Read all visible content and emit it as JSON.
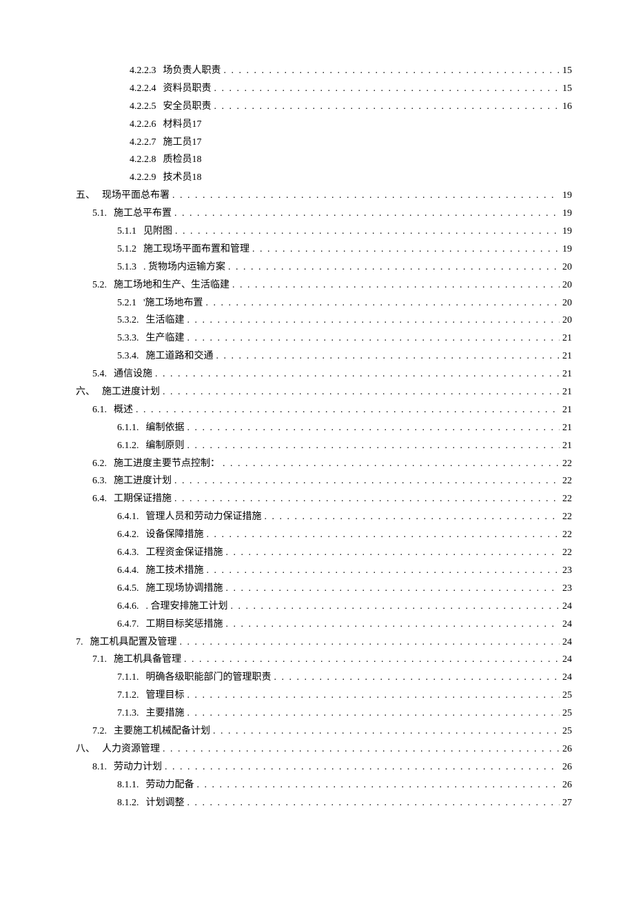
{
  "entries": [
    {
      "level": 4,
      "number": "4.2.2.3",
      "title": "场负责人职责",
      "page": "15",
      "dots": true
    },
    {
      "level": 4,
      "number": "4.2.2.4",
      "title": "资料员职责",
      "page": "15",
      "dots": true
    },
    {
      "level": 4,
      "number": "4.2.2.5",
      "title": "安全员职责",
      "page": "16",
      "dots": true
    },
    {
      "level": 4,
      "number": "4.2.2.6",
      "title": "材料员17",
      "page": "",
      "dots": false
    },
    {
      "level": 4,
      "number": "4.2.2.7",
      "title": "施工员17",
      "page": "",
      "dots": false
    },
    {
      "level": 4,
      "number": "4.2.2.8",
      "title": "质检员18",
      "page": "",
      "dots": false
    },
    {
      "level": 4,
      "number": "4.2.2.9",
      "title": "技术员18",
      "page": "",
      "dots": false
    },
    {
      "level": 0,
      "number": "五、",
      "title": "现场平面总布署",
      "page": "19",
      "dots": true
    },
    {
      "level": 2,
      "number": "5.1.",
      "title": "施工总平布置",
      "page": "19",
      "dots": true
    },
    {
      "level": 3,
      "number": "5.1.1",
      "title": "见附图",
      "page": "19",
      "dots": true
    },
    {
      "level": 3,
      "number": "5.1.2",
      "title": "施工现场平面布置和管理",
      "page": "19",
      "dots": true
    },
    {
      "level": 3,
      "number": "5.1.3",
      "title": ". 货物场内运输方案",
      "page": "20",
      "dots": true
    },
    {
      "level": 2,
      "number": "5.2.",
      "title": "施工场地和生产、生活临建",
      "page": "20",
      "dots": true
    },
    {
      "level": 3,
      "number": "5.2.1",
      "title": "'施工场地布置",
      "page": "20",
      "dots": true
    },
    {
      "level": 3,
      "number": "5.3.2.",
      "title": "生活临建",
      "page": "20",
      "dots": true
    },
    {
      "level": 3,
      "number": "5.3.3.",
      "title": "生产临建",
      "page": "21",
      "dots": true
    },
    {
      "level": 3,
      "number": "5.3.4.",
      "title": "施工道路和交通",
      "page": "21",
      "dots": true
    },
    {
      "level": 2,
      "number": "5.4.",
      "title": "通信设施",
      "page": "21",
      "dots": true
    },
    {
      "level": 0,
      "number": "六、",
      "title": "施工进度计划",
      "page": "21",
      "dots": true
    },
    {
      "level": 2,
      "number": "6.1.",
      "title": "概述",
      "page": "21",
      "dots": true
    },
    {
      "level": 3,
      "number": "6.1.1.",
      "title": "编制依据",
      "page": "21",
      "dots": true
    },
    {
      "level": 3,
      "number": "6.1.2.",
      "title": "编制原则",
      "page": "21",
      "dots": true
    },
    {
      "level": 2,
      "number": "6.2.",
      "title": "施工进度主要节点控制：",
      "page": "22",
      "dots": true
    },
    {
      "level": 2,
      "number": "6.3.",
      "title": "施工进度计划",
      "page": "22",
      "dots": true
    },
    {
      "level": 2,
      "number": "6.4.",
      "title": "工期保证措施",
      "page": "22",
      "dots": true
    },
    {
      "level": 3,
      "number": "6.4.1.",
      "title": "管理人员和劳动力保证措施",
      "page": "22",
      "dots": true
    },
    {
      "level": 3,
      "number": "6.4.2.",
      "title": "设备保障措施",
      "page": "22",
      "dots": true
    },
    {
      "level": 3,
      "number": "6.4.3.",
      "title": "工程资金保证措施",
      "page": "22",
      "dots": true
    },
    {
      "level": 3,
      "number": "6.4.4.",
      "title": "施工技术措施",
      "page": "23",
      "dots": true
    },
    {
      "level": 3,
      "number": "6.4.5.",
      "title": "施工现场协调措施",
      "page": "23",
      "dots": true
    },
    {
      "level": 3,
      "number": "6.4.6.",
      "title": ". 合理安排施工计划",
      "page": "24",
      "dots": true
    },
    {
      "level": 3,
      "number": "6.4.7.",
      "title": "工期目标奖惩措施",
      "page": "24",
      "dots": true
    },
    {
      "level": 0,
      "number": "7.",
      "title": "施工机具配置及管理",
      "page": "24",
      "dots": true
    },
    {
      "level": 2,
      "number": "7.1.",
      "title": "施工机具备管理",
      "page": "24",
      "dots": true
    },
    {
      "level": 3,
      "number": "7.1.1.",
      "title": "明确各级职能部门的管理职责",
      "page": "24",
      "dots": true
    },
    {
      "level": 3,
      "number": "7.1.2.",
      "title": "管理目标",
      "page": "25",
      "dots": true
    },
    {
      "level": 3,
      "number": "7.1.3.",
      "title": "主要措施",
      "page": "25",
      "dots": true
    },
    {
      "level": 2,
      "number": "7.2.",
      "title": "主要施工机械配备计划",
      "page": "25",
      "dots": true
    },
    {
      "level": 0,
      "number": "八、",
      "title": "人力资源管理",
      "page": "26",
      "dots": true
    },
    {
      "level": 2,
      "number": "8.1.",
      "title": "劳动力计划",
      "page": "26",
      "dots": true
    },
    {
      "level": 3,
      "number": "8.1.1.",
      "title": "劳动力配备",
      "page": "26",
      "dots": true
    },
    {
      "level": 3,
      "number": "8.1.2.",
      "title": "计划调整",
      "page": "27",
      "dots": true
    }
  ]
}
